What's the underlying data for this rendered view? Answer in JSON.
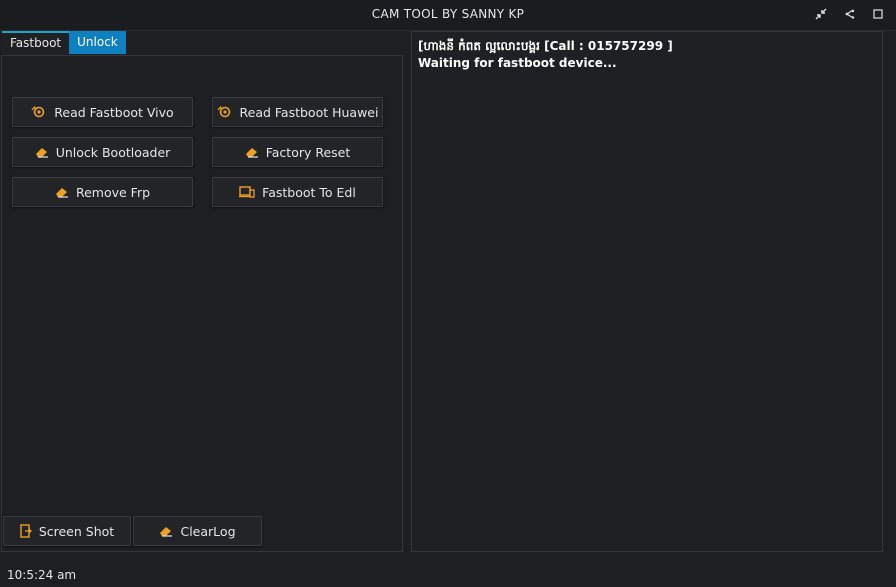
{
  "window": {
    "title": "CAM TOOL BY SANNY KP",
    "icons": [
      "collapse-icon",
      "share-icon",
      "maximize-icon",
      "close-icon"
    ]
  },
  "tabs": [
    {
      "label": "Fastboot",
      "state": "active"
    },
    {
      "label": "Unlock",
      "state": "highlighted"
    }
  ],
  "buttons": {
    "read_fastboot_vivo": "Read Fastboot  Vivo",
    "read_fastboot_huawei": "Read Fastboot  Huawei",
    "unlock_bootloader": "Unlock Bootloader",
    "factory_reset": "Factory Reset",
    "remove_frp": "Remove Frp",
    "fastboot_to_edl": "Fastboot  To Edl",
    "screen_shot": "Screen Shot",
    "clear_log": "ClearLog"
  },
  "log": {
    "lines": [
      "[ហាងនី កំពត ល្អលោះបង្គរ [Call : 015757299 ]",
      "Waiting for fastboot device..."
    ]
  },
  "status": {
    "time": "10:5:24 am"
  },
  "colors": {
    "accent": "#f0a020",
    "tab_blue": "#0e7fbf",
    "tab_line": "#22a3c7"
  }
}
